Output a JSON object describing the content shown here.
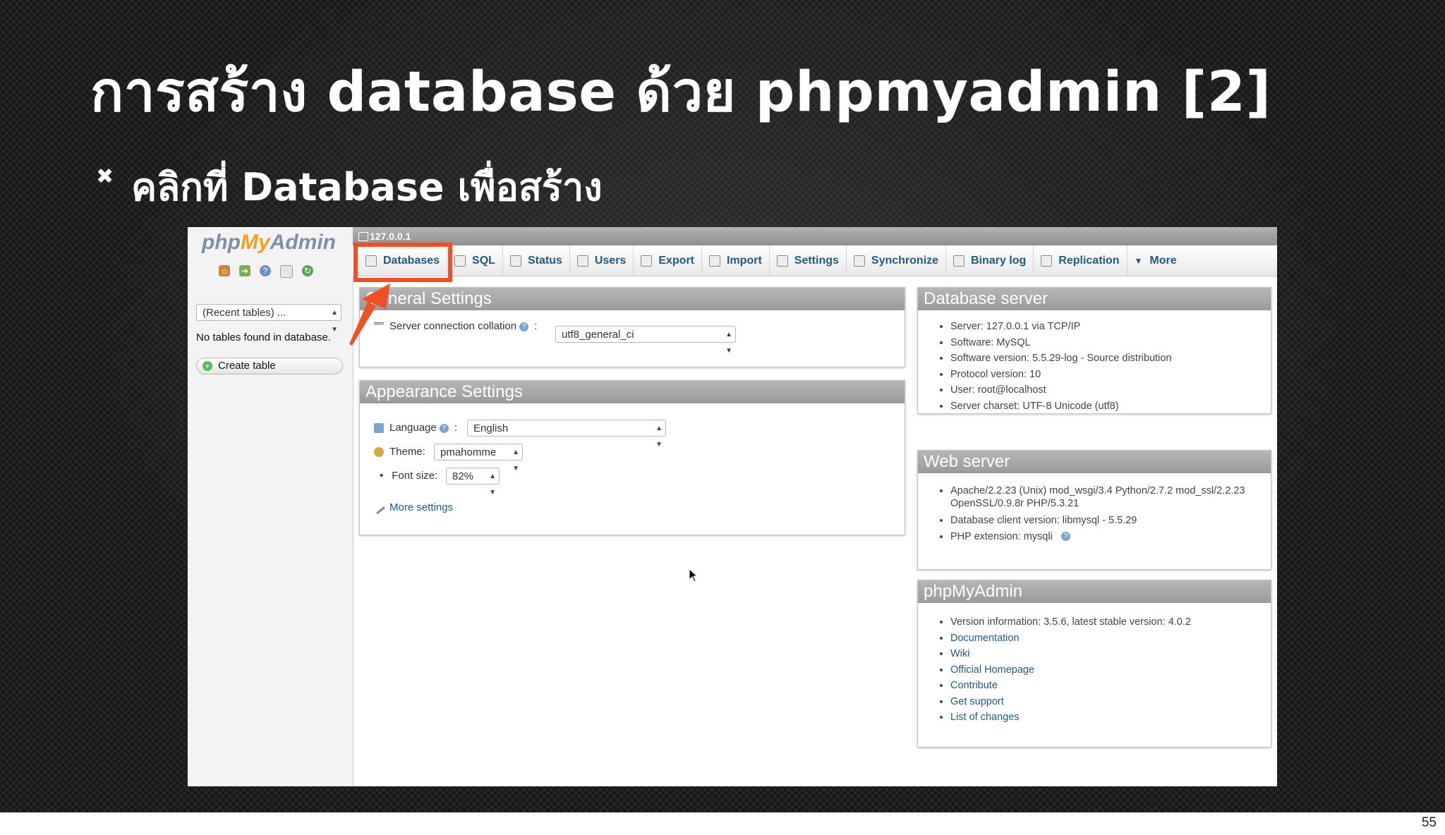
{
  "slide": {
    "title": "การสร้าง database ด้วย phpmyadmin [2]",
    "bullet": "คลิกที่ Database เพื่อสร้าง",
    "page_number": "55",
    "highlight_color": "#f05027"
  },
  "sidebar": {
    "logo_php": "php",
    "logo_my": "My",
    "logo_admin": "Admin",
    "icons": [
      "home-icon",
      "exit-icon",
      "query-icon",
      "docs-icon",
      "reload-icon"
    ],
    "recent_select": "(Recent tables) ...",
    "no_tables": "No tables found in database.",
    "create_table": "Create table"
  },
  "breadcrumb": {
    "server": "127.0.0.1"
  },
  "tabs": [
    {
      "label": "Databases",
      "icon": "database-icon"
    },
    {
      "label": "SQL",
      "icon": "sql-icon"
    },
    {
      "label": "Status",
      "icon": "status-icon"
    },
    {
      "label": "Users",
      "icon": "users-icon"
    },
    {
      "label": "Export",
      "icon": "export-icon"
    },
    {
      "label": "Import",
      "icon": "import-icon"
    },
    {
      "label": "Settings",
      "icon": "wrench-icon"
    },
    {
      "label": "Synchronize",
      "icon": "sync-icon"
    },
    {
      "label": "Binary log",
      "icon": "log-icon"
    },
    {
      "label": "Replication",
      "icon": "replication-icon"
    },
    {
      "label": "More",
      "icon": "chevron-down-icon"
    }
  ],
  "general_settings": {
    "title": "General Settings",
    "collation_label": "Server connection collation",
    "collation_value": "utf8_general_ci"
  },
  "appearance_settings": {
    "title": "Appearance Settings",
    "language_label": "Language",
    "language_value": "English",
    "theme_label": "Theme:",
    "theme_value": "pmahomme",
    "font_size_label": "Font size:",
    "font_size_value": "82%",
    "more_settings": "More settings"
  },
  "database_server": {
    "title": "Database server",
    "items": [
      "Server: 127.0.0.1 via TCP/IP",
      "Software: MySQL",
      "Software version: 5.5.29-log - Source distribution",
      "Protocol version: 10",
      "User: root@localhost",
      "Server charset: UTF-8 Unicode (utf8)"
    ]
  },
  "web_server": {
    "title": "Web server",
    "items": [
      "Apache/2.2.23 (Unix) mod_wsgi/3.4 Python/2.7.2 mod_ssl/2.2.23 OpenSSL/0.9.8r PHP/5.3.21",
      "Database client version: libmysql - 5.5.29",
      "PHP extension: mysqli"
    ]
  },
  "phpmyadmin_panel": {
    "title": "phpMyAdmin",
    "items": [
      "Version information: 3.5.6, latest stable version: 4.0.2",
      "Documentation",
      "Wiki",
      "Official Homepage",
      "Contribute",
      "Get support",
      "List of changes"
    ]
  }
}
